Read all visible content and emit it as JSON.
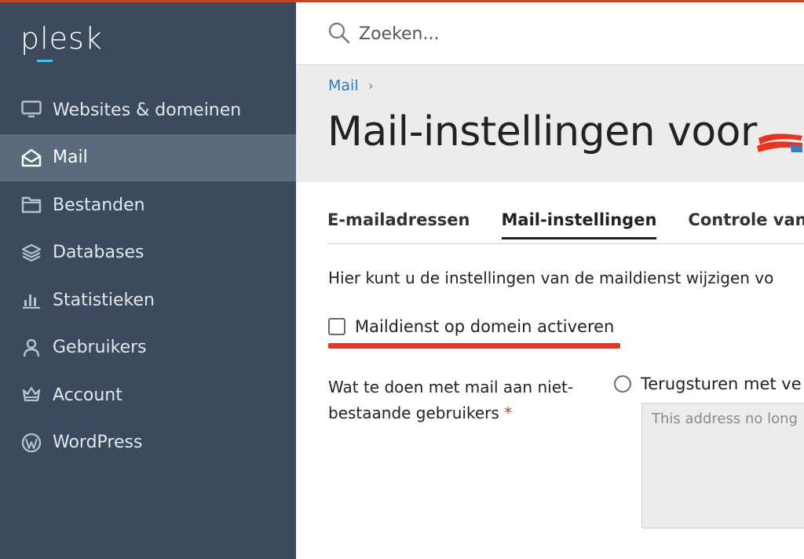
{
  "app": {
    "logo_text": "plesk",
    "accent_color": "#4ec1e8",
    "sidebar_bg": "#3b4a5c",
    "sidebar_active_bg": "#5a6b7e"
  },
  "sidebar": {
    "items": [
      {
        "label": "Websites & domeinen",
        "icon": "monitor-icon"
      },
      {
        "label": "Mail",
        "icon": "envelope-open-icon",
        "active": true
      },
      {
        "label": "Bestanden",
        "icon": "folder-icon"
      },
      {
        "label": "Databases",
        "icon": "layers-icon"
      },
      {
        "label": "Statistieken",
        "icon": "bar-chart-icon"
      },
      {
        "label": "Gebruikers",
        "icon": "user-icon"
      },
      {
        "label": "Account",
        "icon": "crown-icon"
      },
      {
        "label": "WordPress",
        "icon": "wordpress-icon"
      }
    ]
  },
  "search": {
    "placeholder": "Zoeken..."
  },
  "header": {
    "breadcrumb": "Mail",
    "breadcrumb_sep": "›",
    "title": "Mail-instellingen voor"
  },
  "tabs": [
    {
      "label": "E-mailadressen"
    },
    {
      "label": "Mail-instellingen",
      "active": true
    },
    {
      "label": "Controle van u"
    }
  ],
  "form": {
    "description": "Hier kunt u de instellingen van de maildienst wijzigen vo",
    "activate_checkbox_label": "Maildienst op domein activeren",
    "activate_checked": false,
    "nonexistent_label": "Wat te doen met mail aan niet-bestaande gebruikers",
    "required_mark": "*",
    "bounce_option_label": "Terugsturen met ve",
    "bounce_selected": false,
    "bounce_message_placeholder": "This address no long"
  },
  "annotation_color": "#e8341f"
}
